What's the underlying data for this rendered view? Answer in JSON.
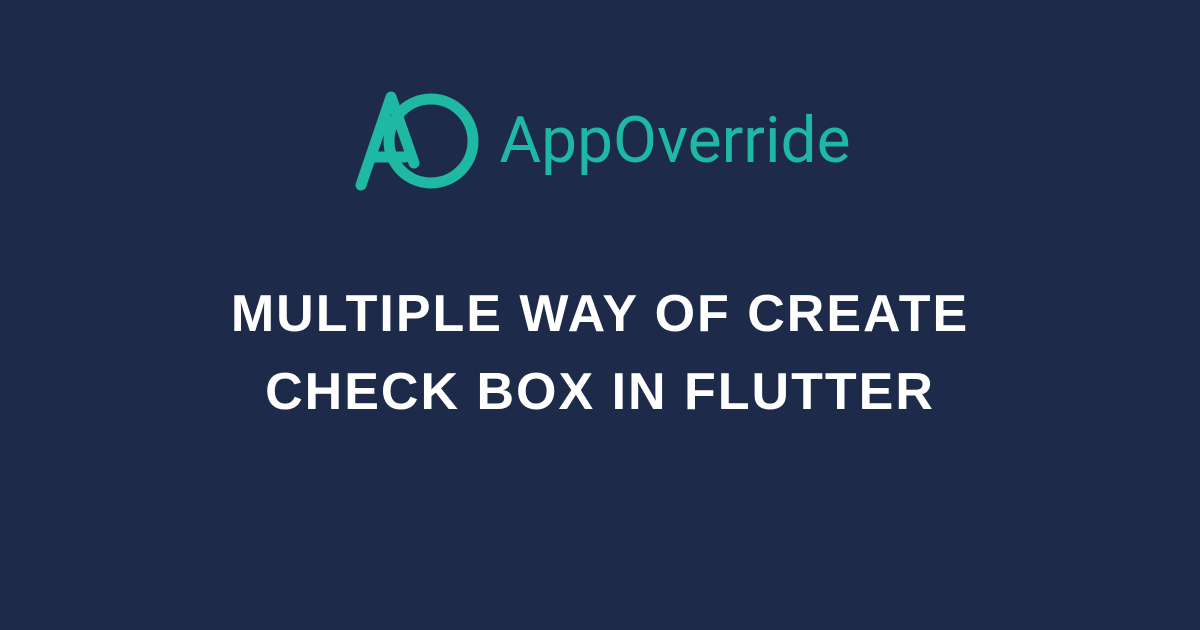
{
  "brand": {
    "name": "AppOverride",
    "accent_color": "#1fb8a3"
  },
  "headline": "Multiple way of create check box in Flutter",
  "background_color": "#1e2a4a",
  "text_color": "#ffffff"
}
